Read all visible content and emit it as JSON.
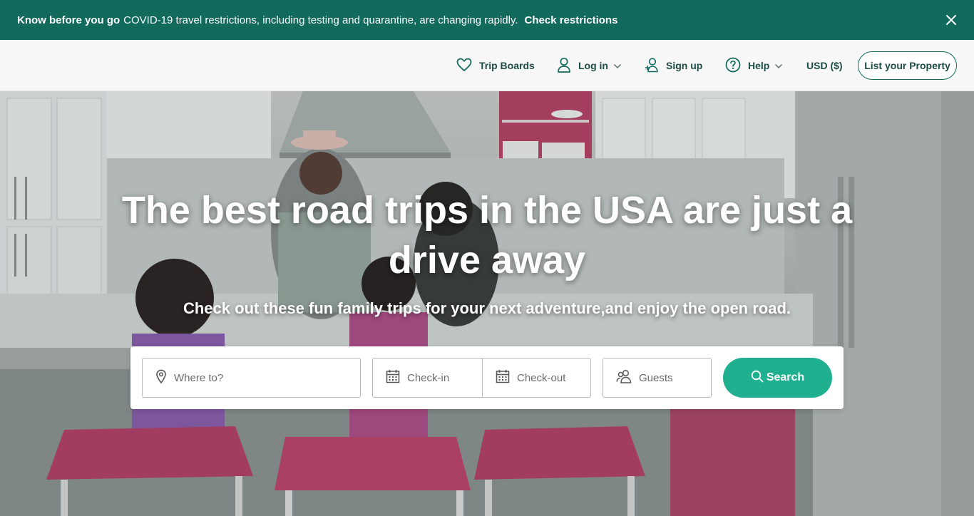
{
  "banner": {
    "bold_text": "Know before you go",
    "message": "COVID-19 travel restrictions, including testing and quarantine, are changing rapidly.",
    "link": "Check restrictions",
    "bg_color": "#116A5C"
  },
  "nav": {
    "trip_boards": "Trip Boards",
    "log_in": "Log in",
    "sign_up": "Sign up",
    "help": "Help",
    "currency": "USD ($)",
    "list_property": "List your Property"
  },
  "hero": {
    "title": "The best road trips in the USA are just a drive away",
    "subtitle": "Check out these fun family trips for your next adventure,and enjoy the open road."
  },
  "search": {
    "where_placeholder": "Where to?",
    "checkin_placeholder": "Check-in",
    "checkout_placeholder": "Check-out",
    "guests_placeholder": "Guests",
    "button_label": "Search",
    "button_color": "#1FB08F"
  },
  "icons": {
    "trip_boards": "heart-icon",
    "log_in": "user-icon",
    "sign_up": "user-plus-icon",
    "help": "help-icon",
    "where": "map-pin-icon",
    "dates": "calendar-icon",
    "guests": "users-icon",
    "search": "search-icon",
    "banner_close": "close-icon"
  }
}
